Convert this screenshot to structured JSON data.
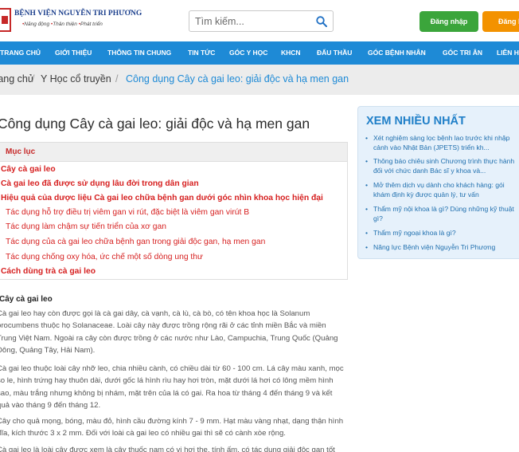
{
  "brand": {
    "name": "BỆNH VIỆN NGUYỄN TRI PHƯƠNG",
    "slogan": [
      "Năng động",
      "Thân thiện",
      "Phát triển"
    ]
  },
  "search": {
    "placeholder": "Tìm kiếm..."
  },
  "auth": {
    "login_label": "Đăng nhập",
    "register_label": "Đăng ký"
  },
  "nav": {
    "items": [
      "TRANG CHỦ",
      "GIỚI THIỆU",
      "THÔNG TIN CHUNG",
      "TIN TỨC",
      "GÓC Y HỌC",
      "KHCN",
      "ĐẤU THẦU",
      "GÓC BỆNH NHÂN",
      "GÓC TRI ÂN",
      "LIÊN HỆ"
    ]
  },
  "breadcrumb": {
    "items": [
      "Trang chủ",
      "Y Học cổ truyền",
      "Công dụng Cây cà gai leo: giải độc và hạ men gan"
    ]
  },
  "article": {
    "title": "Công dụng Cây cà gai leo: giải độc và hạ men gan",
    "toc_title": "Mục lục",
    "toc": [
      {
        "label": "Cây cà gai leo",
        "level": 1
      },
      {
        "label": "Cà gai leo đã được sử dụng lâu đời trong dân gian",
        "level": 1
      },
      {
        "label": "Hiệu quả của dược liệu Cà gai leo chữa bệnh gan dưới góc nhìn khoa học hiện đại",
        "level": 1
      },
      {
        "label": "Tác dụng hỗ trợ điều trị viêm gan vi rút, đặc biệt là viêm gan virút B",
        "level": 2
      },
      {
        "label": "Tác dụng làm chậm sự tiến triển của xơ gan",
        "level": 2
      },
      {
        "label": "Tác dụng của cà gai leo chữa bệnh gan trong giải độc gan, hạ men gan",
        "level": 2
      },
      {
        "label": "Tác dụng chống oxy hóa, ức chế một số dòng ung thư",
        "level": 2
      },
      {
        "label": "Cách dùng trà cà gai leo",
        "level": 1
      }
    ],
    "section_heading": "Cây cà gai leo",
    "paragraphs": [
      "Cà gai leo hay còn được gọi là cà gai dây, cà vạnh, cà lù, cà bò, có tên khoa học là Solanum procumbens thuộc họ Solanaceae. Loài cây này được trồng rộng rãi ở các tỉnh miền Bắc và miền Trung Việt Nam. Ngoài ra cây còn được trồng ở các nước như Lào, Campuchia, Trung Quốc (Quảng Đông, Quảng Tây, Hải Nam).",
      "Cà gai leo thuộc loài cây nhỡ leo, chia nhiều cành, có chiều dài từ 60 - 100 cm. Lá cây màu xanh, mọc so le, hình trứng hay thuôn dài, dưới gốc lá hình rìu hay hơi tròn, mặt dưới lá hơi có lông mềm hình sao, màu trắng nhưng không bị nhám, mặt trên của lá có gai. Ra hoa từ tháng 4 đến tháng 9 và kết quả vào tháng 9 đến tháng 12.",
      "Cây cho quả mọng, bóng, màu đỏ, hình cầu đường kính 7 - 9 mm. Hạt màu vàng nhạt, dạng thận hình đĩa, kích thước 3 x 2 mm. Đối với loài cà gai leo có nhiều gai thì sẽ có cành xòe rộng.",
      "Cà gai leo là loài cây được xem là cây thuốc nam có vị hơi the, tính ấm, có tác dụng giải độc gan tốt nhất"
    ]
  },
  "sidebar": {
    "title": "XEM NHIỀU NHẤT",
    "items": [
      "Xét nghiệm sàng lọc bệnh lao trước khi nhập cảnh vào Nhật Bản (JPETS) triển kh...",
      "Thông báo chiêu sinh Chương trình thực hành đối với chức danh Bác sĩ y khoa và...",
      "Mở thêm dịch vụ dành cho khách hàng: gói khám định kỳ được quản lý, tư vấn",
      "Thẩm mỹ nội khoa là gì? Dùng những kỹ thuật gì?",
      "Thẩm mỹ ngoại khoa là gì?",
      "Năng lực Bệnh viện Nguyễn Tri Phương"
    ]
  },
  "colors": {
    "nav_bg": "#1e8ad6",
    "login_bg": "#3ba53b",
    "register_bg": "#f39200",
    "toc_link": "#d61f1f",
    "sidebar_bg": "#e6f1fb"
  }
}
